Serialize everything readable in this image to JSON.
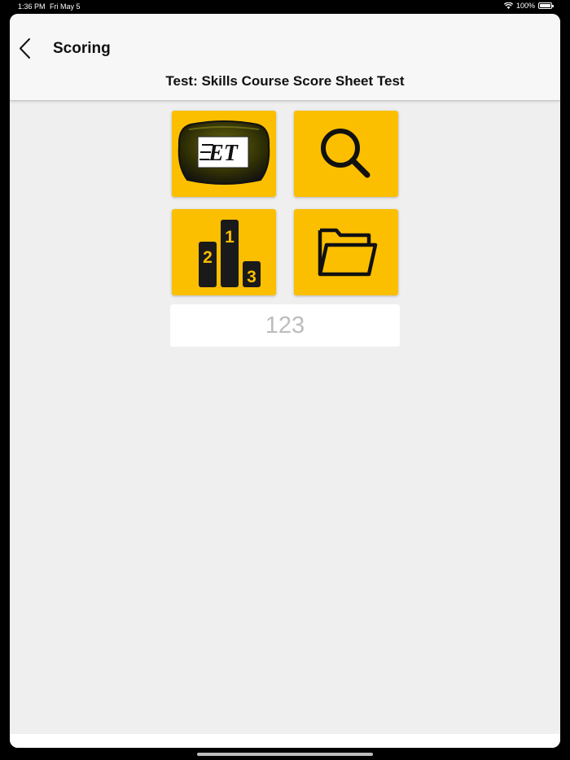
{
  "status_bar": {
    "time": "1:36 PM",
    "date": "Fri May 5",
    "battery": "100%"
  },
  "navbar": {
    "title": "Scoring",
    "back_icon": "chevron-left-icon"
  },
  "subtitle": "Test: Skills Course Score Sheet Test",
  "tiles": [
    {
      "name": "scanner",
      "icon": "et-device-icon",
      "logo_text": "ET"
    },
    {
      "name": "search",
      "icon": "search-icon"
    },
    {
      "name": "leaderboard",
      "icon": "podium-icon",
      "ranks": [
        "1",
        "2",
        "3"
      ]
    },
    {
      "name": "files",
      "icon": "folder-icon"
    }
  ],
  "number_input": {
    "placeholder": "123",
    "value": ""
  },
  "colors": {
    "accent": "#fbbf00",
    "background": "#efefef",
    "navbar": "#f7f7f7"
  }
}
